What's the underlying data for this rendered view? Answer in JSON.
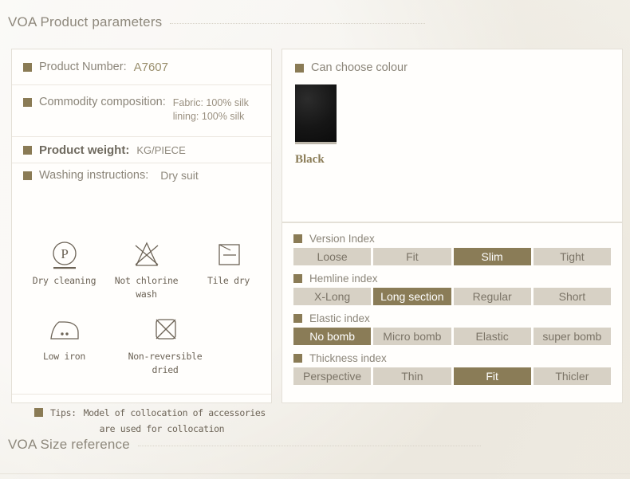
{
  "headings": {
    "product_parameters": "VOA Product parameters",
    "size_reference": "VOA Size reference"
  },
  "left_panel": {
    "product_number": {
      "label": "Product Number:",
      "value": "A7607"
    },
    "composition": {
      "label": "Commodity composition:",
      "lines": [
        "Fabric:  100%  silk",
        "lining:  100%  silk"
      ]
    },
    "weight": {
      "label": "Product  weight:",
      "value": "KG/PIECE"
    },
    "washing": {
      "label": "Washing instructions:",
      "value": "Dry suit"
    },
    "care_symbols": [
      {
        "icon": "dry-cleaning-icon",
        "caption": "Dry cleaning"
      },
      {
        "icon": "no-chlorine-wash-icon",
        "caption": "Not chlorine wash"
      },
      {
        "icon": "tile-dry-icon",
        "caption": "Tile dry"
      },
      {
        "icon": "low-iron-icon",
        "caption": "Low iron"
      },
      {
        "icon": "non-reversible-dried-icon",
        "caption": "Non-reversible\ndried"
      }
    ],
    "tips": {
      "label": "Tips:",
      "line1": "Model of collocation of accessories",
      "line2": "are used for collocation"
    }
  },
  "colour_panel": {
    "title": "Can choose colour",
    "swatches": [
      {
        "name": "Black",
        "hex": "#161616"
      }
    ]
  },
  "index_panel": {
    "groups": [
      {
        "name": "version-index",
        "title": "Version Index",
        "options": [
          "Loose",
          "Fit",
          "Slim",
          "Tight"
        ],
        "selected": 2
      },
      {
        "name": "hemline-index",
        "title": "Hemline index",
        "options": [
          "X-Long",
          "Long  section",
          "Regular",
          "Short"
        ],
        "selected": 1
      },
      {
        "name": "elastic-index",
        "title": "Elastic index",
        "options": [
          "No  bomb",
          "Micro  bomb",
          "Elastic",
          "super  bomb"
        ],
        "selected": 0
      },
      {
        "name": "thickness-index",
        "title": "Thickness index",
        "options": [
          "Perspective",
          "Thin",
          "Fit",
          "Thicler"
        ],
        "selected": 2
      }
    ]
  },
  "colors": {
    "bullet": "#8a7b55",
    "accent_selected": "#8a7c57",
    "option_bg": "#d7d1c5",
    "page_bg": "#f4f1eb"
  }
}
